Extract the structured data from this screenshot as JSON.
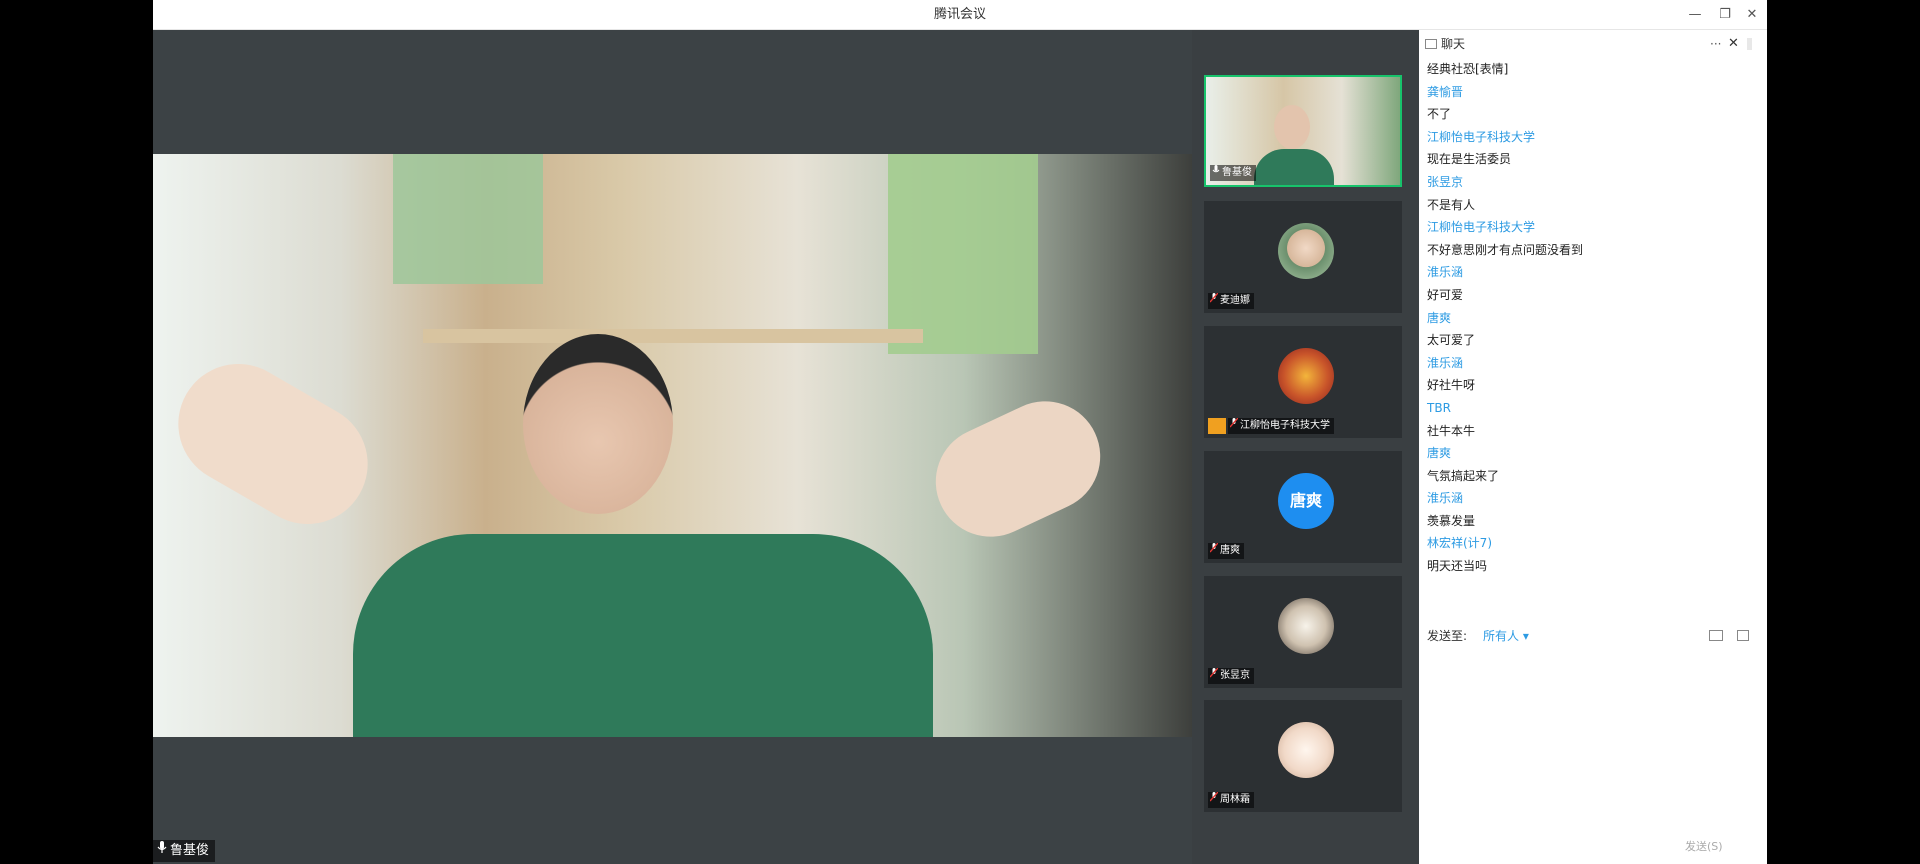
{
  "window": {
    "title": "腾讯会议",
    "controls": {
      "minimize": "—",
      "restore": "❐",
      "close": "✕"
    }
  },
  "main_video": {
    "speaker_name": "鲁基俊"
  },
  "participants": [
    {
      "name": "鲁基俊",
      "type": "video",
      "active": true
    },
    {
      "name": "麦迪娜",
      "type": "avatar-image"
    },
    {
      "name": "江柳怡电子科技大学",
      "type": "avatar-image",
      "host": true
    },
    {
      "name": "唐爽",
      "type": "avatar-text",
      "avatar_text": "唐爽"
    },
    {
      "name": "张昱京",
      "type": "avatar-image"
    },
    {
      "name": "周林霜",
      "type": "avatar-image"
    }
  ],
  "chat": {
    "title": "聊天",
    "more": "···",
    "close": "✕",
    "messages": [
      {
        "text": "经典社恐[表情]"
      },
      {
        "sender": "龚愉晋",
        "text": "不了"
      },
      {
        "sender": "江柳怡电子科技大学",
        "text": "现在是生活委员"
      },
      {
        "sender": "张昱京",
        "text": "不是有人"
      },
      {
        "sender": "江柳怡电子科技大学",
        "text": "不好意思刚才有点问题没看到"
      },
      {
        "sender": "淮乐涵",
        "text": "好可爱"
      },
      {
        "sender": "唐爽",
        "text": "太可爱了"
      },
      {
        "sender": "淮乐涵",
        "text": "好社牛呀"
      },
      {
        "sender": "TBR",
        "text": "社牛本牛"
      },
      {
        "sender": "唐爽",
        "text": "气氛搞起来了"
      },
      {
        "sender": "淮乐涵",
        "text": "羡慕发量"
      },
      {
        "sender": "林宏祥(计7)",
        "text": "明天还当吗"
      }
    ],
    "send_to_label": "发送至:",
    "send_to_value": "所有人 ▾",
    "send_button": "发送(S)"
  },
  "colors": {
    "link": "#2d9be3",
    "active_border": "#17c36b",
    "avatar_blue": "#1e8ef0",
    "stage_bg": "#3c4245"
  }
}
